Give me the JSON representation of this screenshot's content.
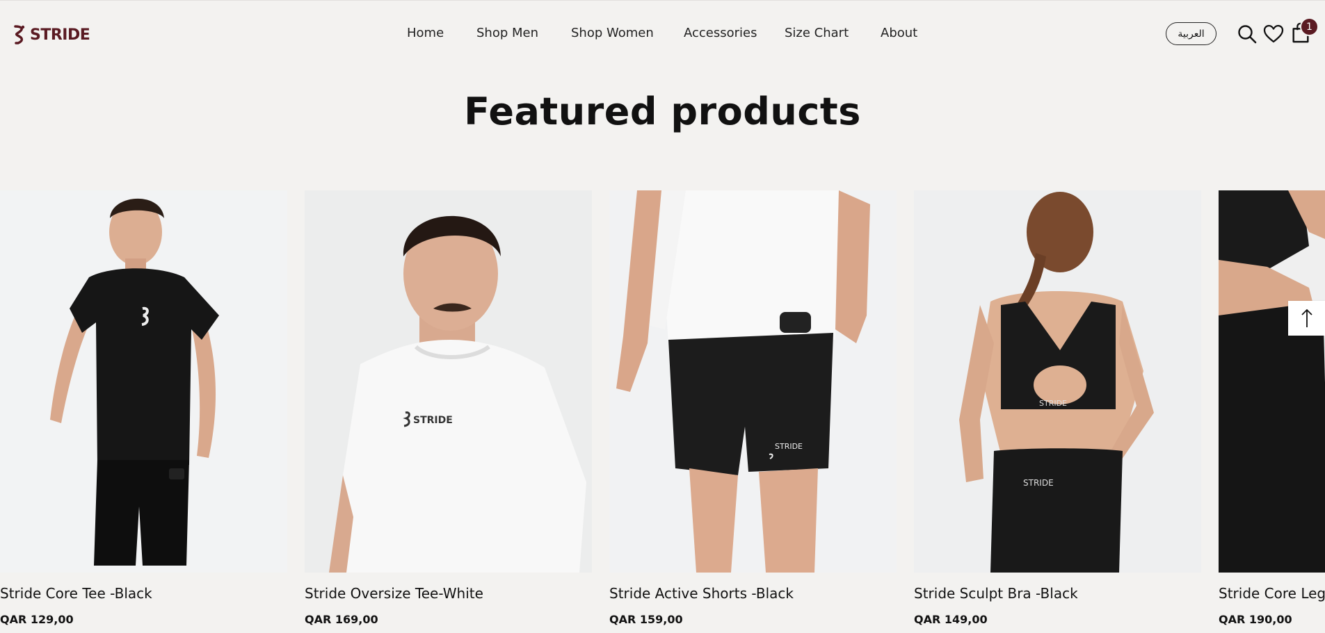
{
  "brand": {
    "name": "STRIDE",
    "color": "#5a1a22"
  },
  "nav": {
    "items": [
      {
        "label": "Home"
      },
      {
        "label": "Shop Men"
      },
      {
        "label": "Shop Women"
      },
      {
        "label": "Accessories"
      },
      {
        "label": "Size Chart"
      },
      {
        "label": "About"
      }
    ]
  },
  "header": {
    "language_label": "العربية",
    "icons": [
      "search-icon",
      "heart-icon",
      "bag-icon"
    ],
    "cart_count": "1"
  },
  "section": {
    "title": "Featured products"
  },
  "products": [
    {
      "title": "Stride Core Tee -Black",
      "price": "QAR 129,00"
    },
    {
      "title": "Stride Oversize Tee-White",
      "price": "QAR 169,00"
    },
    {
      "title": "Stride Active Shorts -Black",
      "price": "QAR 159,00"
    },
    {
      "title": "Stride Sculpt Bra -Black",
      "price": "QAR 149,00"
    },
    {
      "title": "Stride Core Legg",
      "price": "QAR 190,00"
    }
  ],
  "scroll_top_icon": "arrow-up-icon"
}
